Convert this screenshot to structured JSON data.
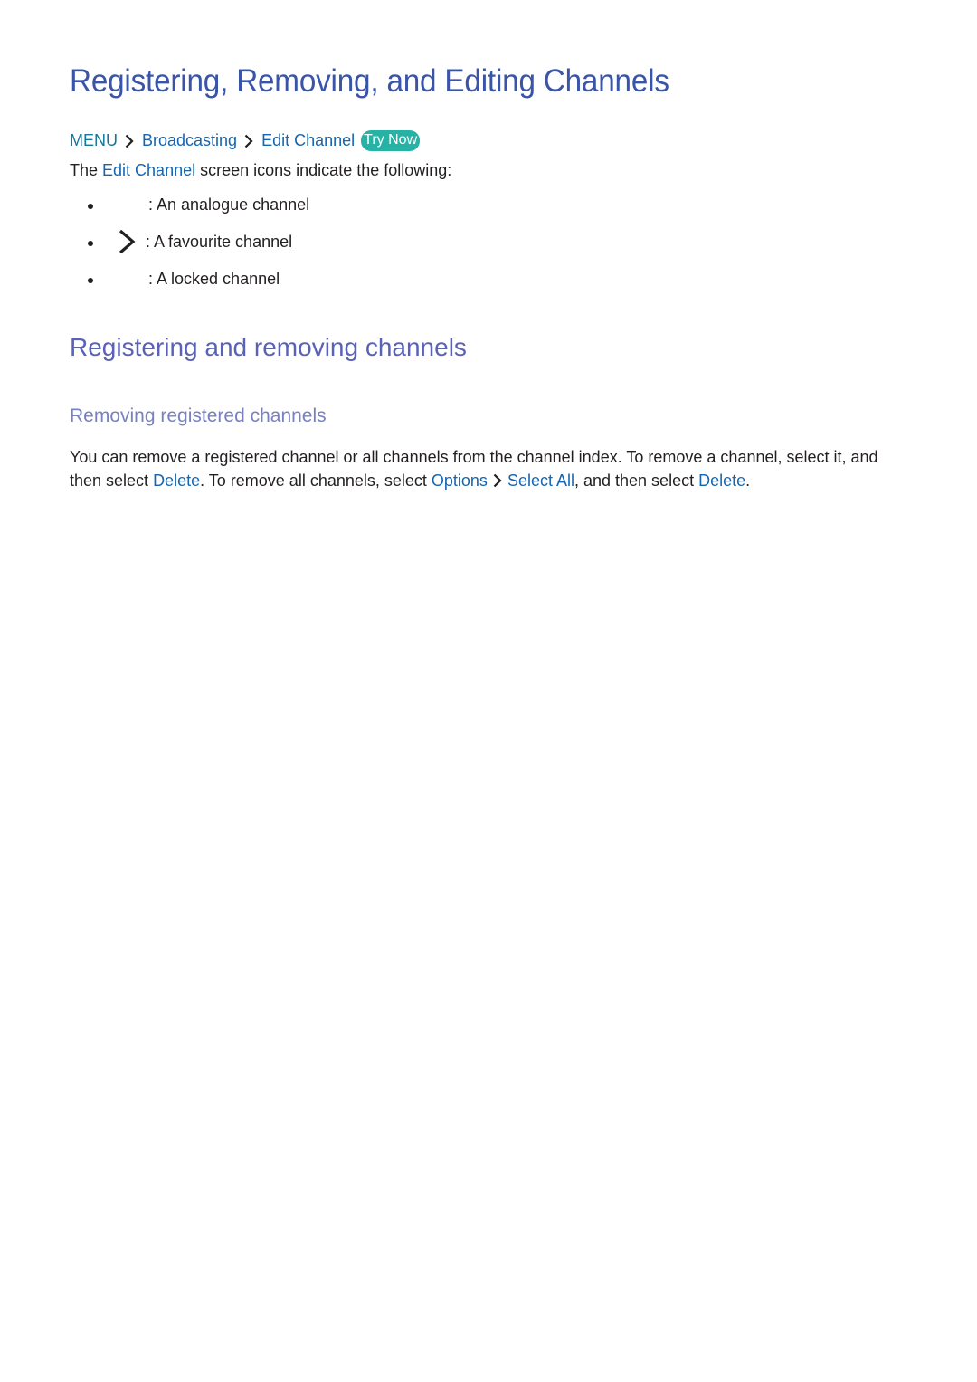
{
  "title": "Registering, Removing, and Editing Channels",
  "breadcrumb": {
    "items": [
      "MENU",
      "Broadcasting",
      "Edit Channel"
    ],
    "separator_icon": "chevron-right-icon",
    "try_now": "Try Now"
  },
  "intro": {
    "prefix": "The ",
    "keyword": "Edit Channel",
    "suffix": " screen icons indicate the following:"
  },
  "icon_legend": [
    {
      "icon": "analogue-channel-icon",
      "text": ": An analogue channel"
    },
    {
      "icon": "favourite-channel-icon",
      "text": ": A favourite channel"
    },
    {
      "icon": "locked-channel-icon",
      "text": ": A locked channel"
    }
  ],
  "section": {
    "heading": "Registering and removing channels",
    "subheading": "Removing registered channels",
    "paragraph": {
      "t1": "You can remove a registered channel or all channels from the channel index. To remove a channel, select it, and then select ",
      "k1": "Delete",
      "t2": ". To remove all channels, select ",
      "k2": "Options",
      "k3": "Select All",
      "t3": ", and then select ",
      "k4": "Delete",
      "t4": "."
    }
  },
  "colors": {
    "title": "#3a55a8",
    "heading": "#5a62b8",
    "subheading": "#7880c2",
    "link": "#1565b0",
    "menu": "#14779a",
    "try_now_bg": "#26b3a6",
    "text": "#231f20"
  }
}
